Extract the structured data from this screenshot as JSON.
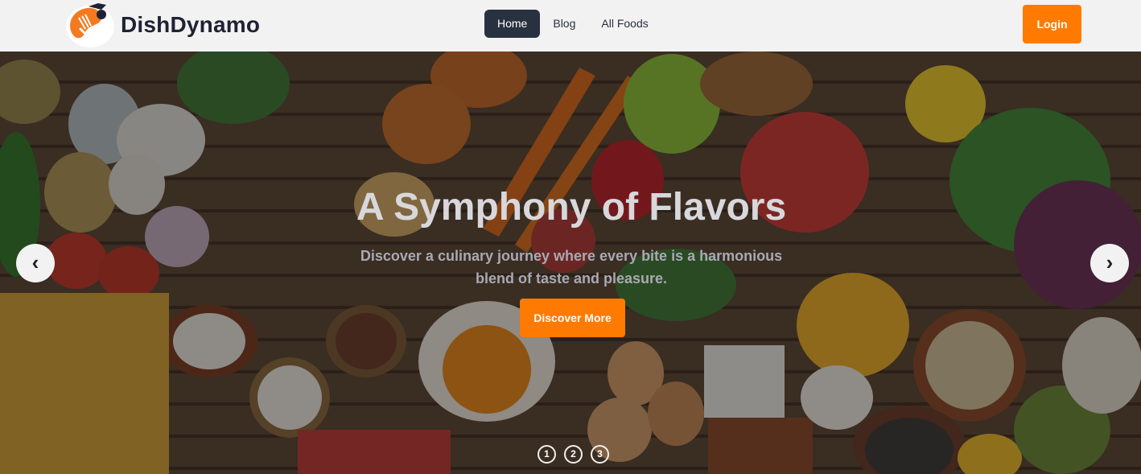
{
  "brand": {
    "name": "DishDynamo",
    "logo_icon": "chef-spatula-fork-logo"
  },
  "nav": {
    "links": [
      {
        "label": "Home",
        "active": true
      },
      {
        "label": "Blog",
        "active": false
      },
      {
        "label": "All Foods",
        "active": false
      }
    ],
    "login_label": "Login"
  },
  "hero": {
    "title": "A Symphony of Flavors",
    "subtitle": "Discover a culinary journey where every bite is a harmonious blend of taste and pleasure.",
    "cta_label": "Discover More",
    "prev_label": "‹",
    "next_label": "›",
    "slides": [
      "1",
      "2",
      "3"
    ],
    "background": "assorted-fresh-vegetables-fruits-photo"
  },
  "colors": {
    "accent": "#ff7a00",
    "nav_active_bg": "#283140",
    "navbar_bg": "#f2f2f2",
    "brand_text": "#1f2233"
  }
}
